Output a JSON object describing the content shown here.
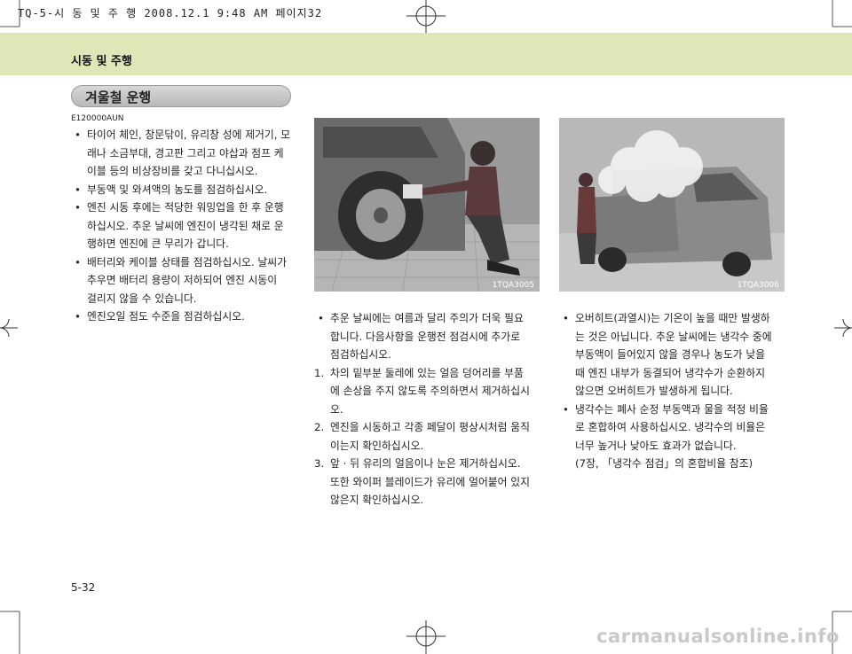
{
  "print_header": "TQ-5-시 동 및 주 행  2008.12.1 9:48 AM 페이지32",
  "section_title": "시동 및 주행",
  "heading": "겨울철 운행",
  "doc_code": "E120000AUN",
  "left_bullets": [
    [
      "타이어 체인, 창문닦이, 유리창 성에 제거기, 모",
      "래나 소금부대, 경고판 그리고 야삽과 점프 케",
      "이블 등의 비상장비를 갖고 다니십시오."
    ],
    [
      "부동액 및 와셔액의 농도를 점검하십시오."
    ],
    [
      "엔진 시동 후에는 적당한 워밍업을 한 후 운행",
      "하십시오.  추운 날씨에 엔진이 냉각된 채로 운",
      "행하면 엔진에 큰 무리가 갑니다."
    ],
    [
      "배터리와 케이블 상태를 점검하십시오. 날씨가",
      "추우면 배터리 용량이 저하되어 엔진 시동이",
      "걸리지 않을 수 있습니다."
    ],
    [
      "엔진오일 점도 수준을 점검하십시오."
    ]
  ],
  "photo1_code": "1TQA3005",
  "photo2_code": "1TQA3006",
  "middle_intro": [
    "추운 날씨에는 여름과 달리 주의가 더욱 필요",
    "합니다.  다음사항을 운행전 점검시에 추가로",
    "점검하십시오."
  ],
  "middle_steps": [
    {
      "num": "1.",
      "lines": [
        "차의 밑부분 둘레에 있는 얼음 덩어리를 부품",
        "에 손상을 주지 않도록 주의하면서 제거하십시",
        "오."
      ]
    },
    {
      "num": "2.",
      "lines": [
        "엔진을 시동하고 각종 페달이 평상시처럼 움직",
        "이는지 확인하십시오."
      ]
    },
    {
      "num": "3.",
      "lines": [
        "앞 · 뒤 유리의 얼음이나 눈은 제거하십시오.",
        "또한 와이퍼 블레이드가 유리에 얼어붙어 있지",
        "않은지 확인하십시오."
      ]
    }
  ],
  "right_bullets": [
    [
      "오버히트(과열시)는 기온이 높을 때만 발생하",
      "는 것은 아닙니다.  추운 날씨에는 냉각수 중에",
      "부동액이 들어있지 않을 경우나 농도가 낮을",
      "때  엔진 내부가 동결되어 냉각수가 순환하지",
      "않으면 오버히트가 발생하게 됩니다."
    ],
    [
      "냉각수는 폐사 순정 부동액과 물을 적정 비율",
      "로 혼합하여 사용하십시오.  냉각수의 비율은",
      "너무 높거나 낮아도 효과가 없습니다."
    ]
  ],
  "right_note": "(7장, 「냉각수 점검」의 혼합비율 참조)",
  "page_number": "5-32",
  "watermark": "carmanualsonline.info",
  "colors": {
    "band": "#dfe7b8",
    "pill": "#c4c4c4",
    "photo": "#8e8e8e"
  }
}
